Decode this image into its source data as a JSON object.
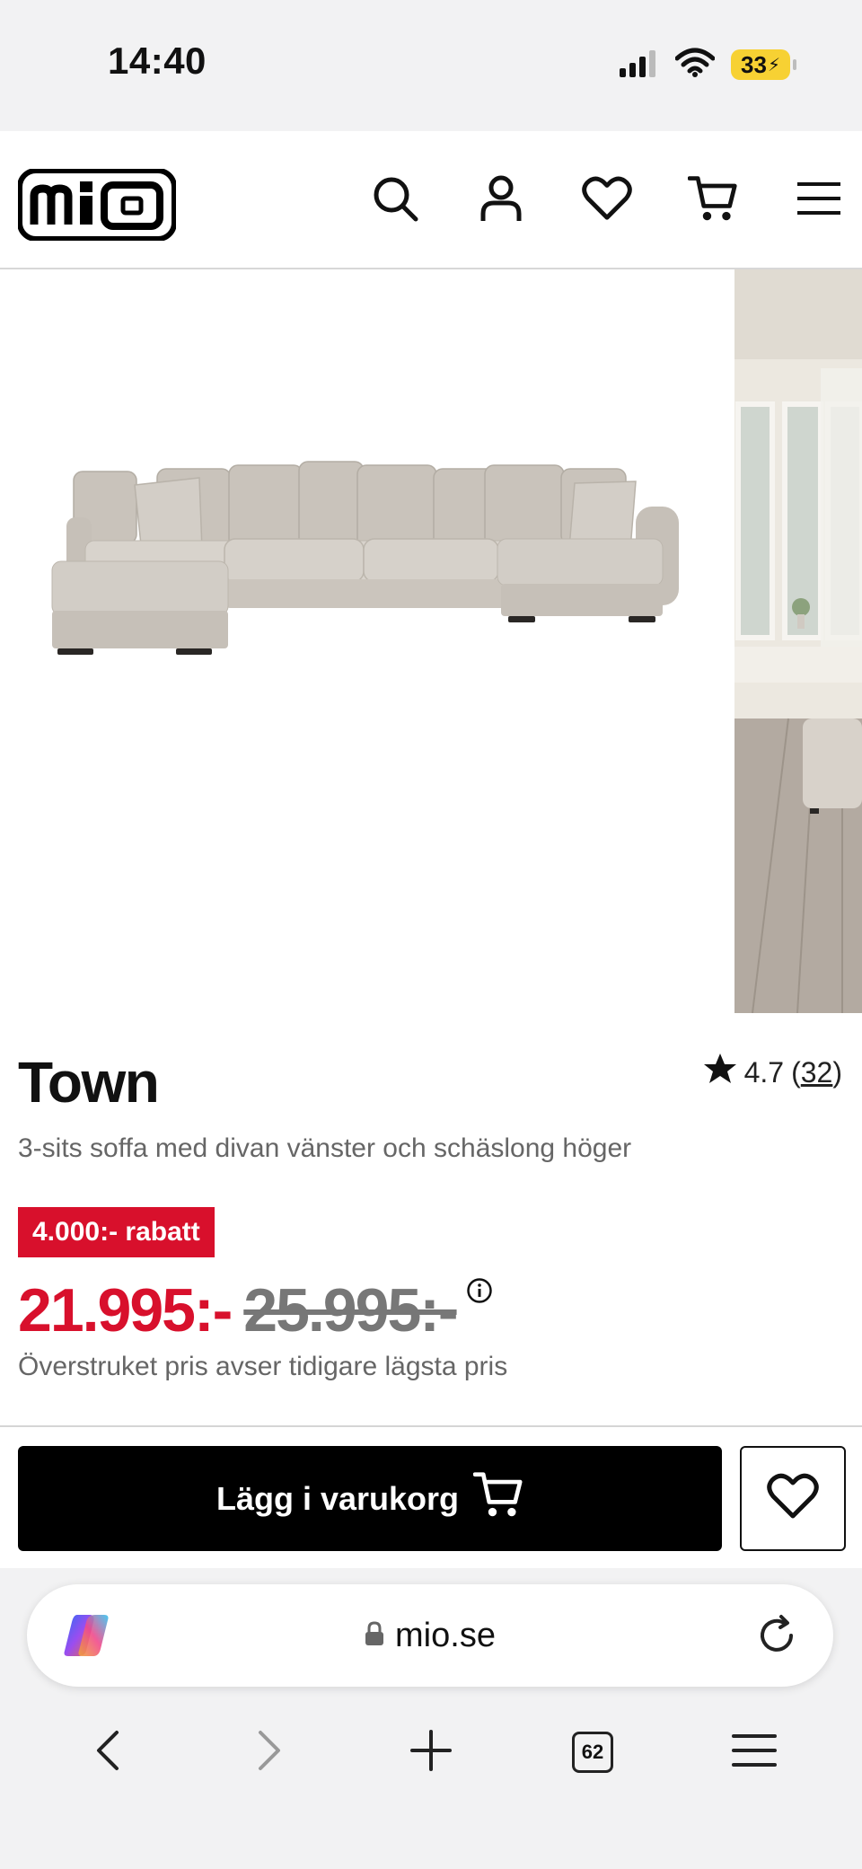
{
  "status": {
    "time": "14:40",
    "battery": "33"
  },
  "header": {
    "logo_text": "mio",
    "icons": [
      "search-icon",
      "account-icon",
      "heart-icon",
      "cart-icon",
      "menu-icon"
    ]
  },
  "product": {
    "title": "Town",
    "rating_value": "4.7",
    "rating_open": "(",
    "rating_count": "32",
    "rating_close": ")",
    "subtitle": "3-sits soffa med divan vänster och schäslong höger",
    "discount_badge": "4.000:- rabatt",
    "price_now": "21.995:-",
    "price_old": "25.995:-",
    "price_note": "Överstruket pris avser tidigare lägsta pris",
    "add_to_cart_label": "Lägg i varukorg"
  },
  "browser": {
    "url": "mio.se",
    "tab_count": "62"
  },
  "colors": {
    "accent_red": "#d8102c",
    "button_black": "#000000",
    "battery_yellow": "#f7d133"
  }
}
